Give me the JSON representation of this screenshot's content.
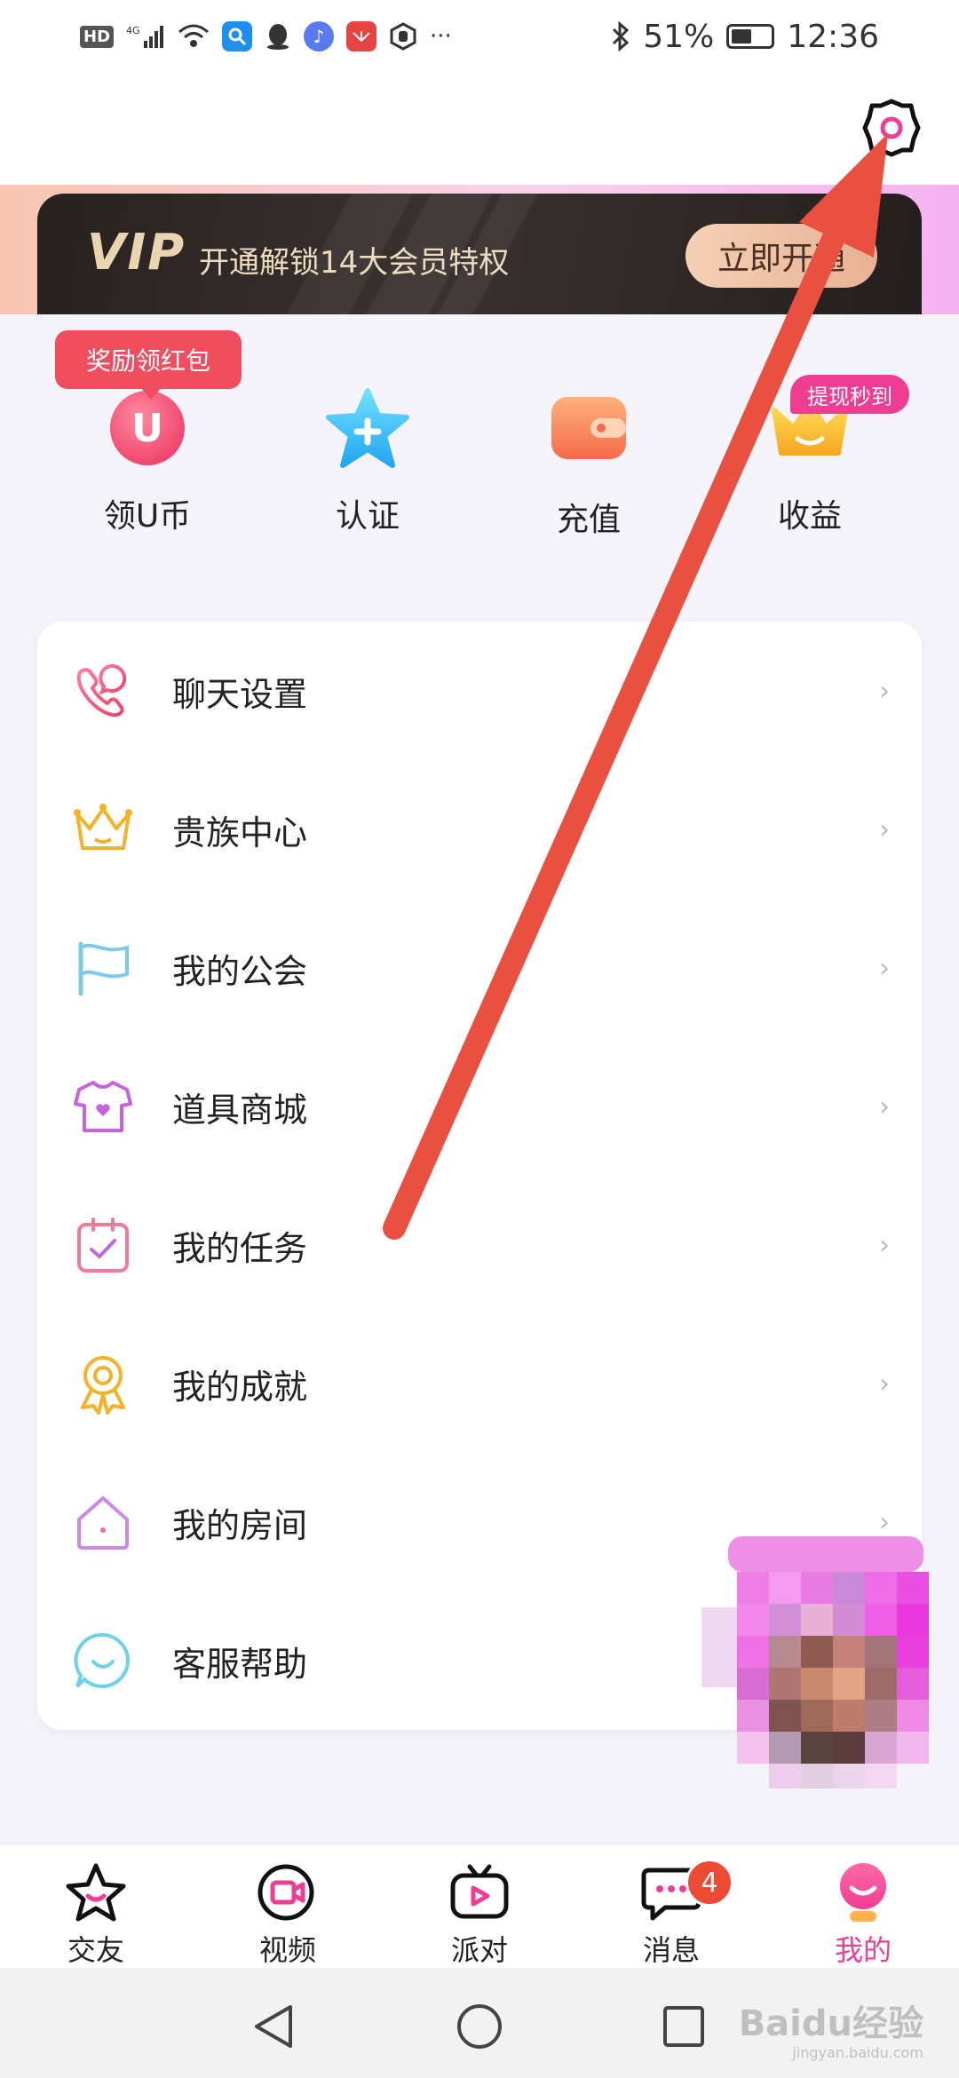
{
  "status_bar": {
    "hd": "HD",
    "network": "4G",
    "battery": "51%",
    "time": "12:36",
    "more": "···"
  },
  "vip": {
    "logo": "VIP",
    "text": "开通解锁14大会员特权",
    "button": "立即开通"
  },
  "quick_actions": {
    "badge_reward": "奖励领红包",
    "badge_withdraw": "提现秒到",
    "items": [
      {
        "label": "领U币",
        "icon": "u-coin-icon",
        "glyph": "U"
      },
      {
        "label": "认证",
        "icon": "star-plus-icon"
      },
      {
        "label": "充值",
        "icon": "wallet-icon"
      },
      {
        "label": "收益",
        "icon": "crown-icon"
      }
    ]
  },
  "menu": {
    "items": [
      {
        "label": "聊天设置",
        "icon": "phone-chat-icon"
      },
      {
        "label": "贵族中心",
        "icon": "crown-icon"
      },
      {
        "label": "我的公会",
        "icon": "flag-icon"
      },
      {
        "label": "道具商城",
        "icon": "tshirt-icon"
      },
      {
        "label": "我的任务",
        "icon": "task-check-icon"
      },
      {
        "label": "我的成就",
        "icon": "medal-icon"
      },
      {
        "label": "我的房间",
        "icon": "house-icon"
      },
      {
        "label": "客服帮助",
        "icon": "smile-chat-icon"
      }
    ],
    "chevron": "›"
  },
  "bottom_nav": {
    "items": [
      {
        "label": "交友",
        "icon": "star-icon"
      },
      {
        "label": "视频",
        "icon": "video-camera-icon"
      },
      {
        "label": "派对",
        "icon": "tv-play-icon"
      },
      {
        "label": "消息",
        "icon": "message-icon",
        "badge": "4"
      },
      {
        "label": "我的",
        "icon": "profile-icon",
        "active": true
      }
    ]
  },
  "watermark": {
    "text": "Baidu经验",
    "sub": "jingyan.baidu.com"
  },
  "colors": {
    "accent": "#ee3d93",
    "arrow": "#e9503f",
    "vip_gold": "#e9d6b0"
  }
}
